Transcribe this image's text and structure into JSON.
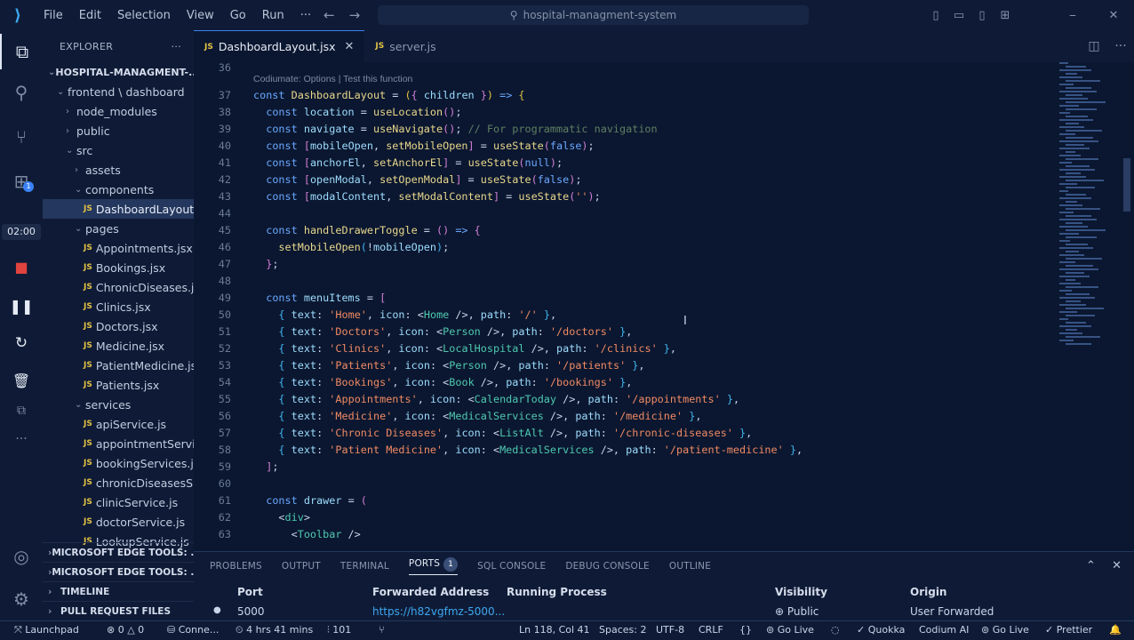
{
  "titlebar": {
    "menu": [
      "File",
      "Edit",
      "Selection",
      "View",
      "Go",
      "Run",
      "···"
    ],
    "search": "hospital-managment-system"
  },
  "activity": {
    "timer": "02:00",
    "badge": "1"
  },
  "explorer": {
    "title": "EXPLORER",
    "root": "HOSPITAL-MANAGMENT-...",
    "items": [
      {
        "label": "frontend \\ dashboard",
        "depth": 1,
        "type": "folder-open"
      },
      {
        "label": "node_modules",
        "depth": 2,
        "type": "folder"
      },
      {
        "label": "public",
        "depth": 2,
        "type": "folder"
      },
      {
        "label": "src",
        "depth": 2,
        "type": "folder-open"
      },
      {
        "label": "assets",
        "depth": 3,
        "type": "folder"
      },
      {
        "label": "components",
        "depth": 3,
        "type": "folder-open"
      },
      {
        "label": "DashboardLayout....",
        "depth": 4,
        "type": "file",
        "selected": true
      },
      {
        "label": "pages",
        "depth": 3,
        "type": "folder-open"
      },
      {
        "label": "Appointments.jsx",
        "depth": 4,
        "type": "file"
      },
      {
        "label": "Bookings.jsx",
        "depth": 4,
        "type": "file"
      },
      {
        "label": "ChronicDiseases.jsx",
        "depth": 4,
        "type": "file"
      },
      {
        "label": "Clinics.jsx",
        "depth": 4,
        "type": "file"
      },
      {
        "label": "Doctors.jsx",
        "depth": 4,
        "type": "file"
      },
      {
        "label": "Medicine.jsx",
        "depth": 4,
        "type": "file"
      },
      {
        "label": "PatientMedicine.jsx",
        "depth": 4,
        "type": "file"
      },
      {
        "label": "Patients.jsx",
        "depth": 4,
        "type": "file"
      },
      {
        "label": "services",
        "depth": 3,
        "type": "folder-open"
      },
      {
        "label": "apiService.js",
        "depth": 4,
        "type": "file"
      },
      {
        "label": "appointmentServi...",
        "depth": 4,
        "type": "file"
      },
      {
        "label": "bookingServices.js",
        "depth": 4,
        "type": "file"
      },
      {
        "label": "chronicDiseasesS...",
        "depth": 4,
        "type": "file"
      },
      {
        "label": "clinicService.js",
        "depth": 4,
        "type": "file"
      },
      {
        "label": "doctorService.js",
        "depth": 4,
        "type": "file"
      },
      {
        "label": "LookupService.js",
        "depth": 4,
        "type": "file"
      }
    ],
    "sections": [
      "MICROSOFT EDGE TOOLS: ...",
      "MICROSOFT EDGE TOOLS: ...",
      "TIMELINE",
      "PULL REQUEST FILES"
    ]
  },
  "tabs": [
    {
      "label": "DashboardLayout.jsx",
      "active": true
    },
    {
      "label": "server.js",
      "active": false
    }
  ],
  "codelens": "Codiumate: Options | Test this function",
  "code": [
    {
      "n": "36",
      "html": ""
    },
    {
      "n": "37",
      "html": "<span class='kw'>const</span> <span class='fn'>DashboardLayout</span> <span class='pun'>=</span> <span class='br1'>(</span><span class='br2'>{</span> <span class='var'>children</span> <span class='br2'>}</span><span class='br1'>)</span> <span class='kw'>=&gt;</span> <span class='br1'>{</span>"
    },
    {
      "n": "38",
      "html": "  <span class='kw'>const</span> <span class='var'>location</span> = <span class='fn'>useLocation</span><span class='br2'>()</span>;"
    },
    {
      "n": "39",
      "html": "  <span class='kw'>const</span> <span class='var'>navigate</span> = <span class='fn'>useNavigate</span><span class='br2'>()</span>; <span class='cm'>// For programmatic navigation</span>"
    },
    {
      "n": "40",
      "html": "  <span class='kw'>const</span> <span class='br2'>[</span><span class='var'>mobileOpen</span>, <span class='fn'>setMobileOpen</span><span class='br2'>]</span> = <span class='fn'>useState</span><span class='br2'>(</span><span class='kw'>false</span><span class='br2'>)</span>;"
    },
    {
      "n": "41",
      "html": "  <span class='kw'>const</span> <span class='br2'>[</span><span class='var'>anchorEl</span>, <span class='fn'>setAnchorEl</span><span class='br2'>]</span> = <span class='fn'>useState</span><span class='br2'>(</span><span class='kw'>null</span><span class='br2'>)</span>;"
    },
    {
      "n": "42",
      "html": "  <span class='kw'>const</span> <span class='br2'>[</span><span class='var'>openModal</span>, <span class='fn'>setOpenModal</span><span class='br2'>]</span> = <span class='fn'>useState</span><span class='br2'>(</span><span class='kw'>false</span><span class='br2'>)</span>;"
    },
    {
      "n": "43",
      "html": "  <span class='kw'>const</span> <span class='br2'>[</span><span class='var'>modalContent</span>, <span class='fn'>setModalContent</span><span class='br2'>]</span> = <span class='fn'>useState</span><span class='br2'>(</span><span class='str'>''</span><span class='br2'>)</span>;"
    },
    {
      "n": "44",
      "html": ""
    },
    {
      "n": "45",
      "html": "  <span class='kw'>const</span> <span class='fn'>handleDrawerToggle</span> = <span class='br2'>()</span> <span class='kw'>=&gt;</span> <span class='br2'>{</span>"
    },
    {
      "n": "46",
      "html": "    <span class='fn'>setMobileOpen</span><span class='br3'>(</span>!<span class='var'>mobileOpen</span><span class='br3'>)</span>;"
    },
    {
      "n": "47",
      "html": "  <span class='br2'>}</span>;"
    },
    {
      "n": "48",
      "html": ""
    },
    {
      "n": "49",
      "html": "  <span class='kw'>const</span> <span class='var'>menuItems</span> = <span class='br2'>[</span>"
    },
    {
      "n": "50",
      "html": "    <span class='br3'>{</span> <span class='var'>text</span>: <span class='str'>'Home'</span>, <span class='var'>icon</span>: &lt;<span class='tag'>Home</span> /&gt;, <span class='var'>path</span>: <span class='str'>'/'</span> <span class='br3'>}</span>,"
    },
    {
      "n": "51",
      "html": "    <span class='br3'>{</span> <span class='var'>text</span>: <span class='str'>'Doctors'</span>, <span class='var'>icon</span>: &lt;<span class='tag'>Person</span> /&gt;, <span class='var'>path</span>: <span class='str'>'/doctors'</span> <span class='br3'>}</span>,"
    },
    {
      "n": "52",
      "html": "    <span class='br3'>{</span> <span class='var'>text</span>: <span class='str'>'Clinics'</span>, <span class='var'>icon</span>: &lt;<span class='tag'>LocalHospital</span> /&gt;, <span class='var'>path</span>: <span class='str'>'/clinics'</span> <span class='br3'>}</span>,"
    },
    {
      "n": "53",
      "html": "    <span class='br3'>{</span> <span class='var'>text</span>: <span class='str'>'Patients'</span>, <span class='var'>icon</span>: &lt;<span class='tag'>Person</span> /&gt;, <span class='var'>path</span>: <span class='str'>'/patients'</span> <span class='br3'>}</span>,"
    },
    {
      "n": "54",
      "html": "    <span class='br3'>{</span> <span class='var'>text</span>: <span class='str'>'Bookings'</span>, <span class='var'>icon</span>: &lt;<span class='tag'>Book</span> /&gt;, <span class='var'>path</span>: <span class='str'>'/bookings'</span> <span class='br3'>}</span>,"
    },
    {
      "n": "55",
      "html": "    <span class='br3'>{</span> <span class='var'>text</span>: <span class='str'>'Appointments'</span>, <span class='var'>icon</span>: &lt;<span class='tag'>CalendarToday</span> /&gt;, <span class='var'>path</span>: <span class='str'>'/appointments'</span> <span class='br3'>}</span>,"
    },
    {
      "n": "56",
      "html": "    <span class='br3'>{</span> <span class='var'>text</span>: <span class='str'>'Medicine'</span>, <span class='var'>icon</span>: &lt;<span class='tag'>MedicalServices</span> /&gt;, <span class='var'>path</span>: <span class='str'>'/medicine'</span> <span class='br3'>}</span>,"
    },
    {
      "n": "57",
      "html": "    <span class='br3'>{</span> <span class='var'>text</span>: <span class='str'>'Chronic Diseases'</span>, <span class='var'>icon</span>: &lt;<span class='tag'>ListAlt</span> /&gt;, <span class='var'>path</span>: <span class='str'>'/chronic-diseases'</span> <span class='br3'>}</span>,"
    },
    {
      "n": "58",
      "html": "    <span class='br3'>{</span> <span class='var'>text</span>: <span class='str'>'Patient Medicine'</span>, <span class='var'>icon</span>: &lt;<span class='tag'>MedicalServices</span> /&gt;, <span class='var'>path</span>: <span class='str'>'/patient-medicine'</span> <span class='br3'>}</span>,"
    },
    {
      "n": "59",
      "html": "  <span class='br2'>]</span>;"
    },
    {
      "n": "60",
      "html": ""
    },
    {
      "n": "61",
      "html": "  <span class='kw'>const</span> <span class='var'>drawer</span> = <span class='br2'>(</span>"
    },
    {
      "n": "62",
      "html": "    &lt;<span class='tag'>div</span>&gt;"
    },
    {
      "n": "63",
      "html": "      &lt;<span class='tag'>Toolbar</span> /&gt;"
    }
  ],
  "panel": {
    "tabs": [
      "PROBLEMS",
      "OUTPUT",
      "TERMINAL",
      "PORTS",
      "SQL CONSOLE",
      "DEBUG CONSOLE",
      "OUTLINE"
    ],
    "ports_count": "1",
    "columns": [
      "Port",
      "Forwarded Address",
      "Running Process",
      "Visibility",
      "Origin"
    ],
    "row": {
      "port": "5000",
      "address": "https://h82vgfmz-5000...",
      "process": "",
      "visibility": "Public",
      "origin": "User Forwarded"
    }
  },
  "status": {
    "remote": "Launchpad",
    "problems": "0 △ 0",
    "connect": "Conne...",
    "time": "4 hrs 41 mins",
    "ports": "101",
    "position": "Ln 118, Col 41",
    "spaces": "Spaces: 2",
    "encoding": "UTF-8",
    "eol": "CRLF",
    "braces": "{}",
    "golive1": "Go Live",
    "quokka": "Quokka",
    "codium": "Codium AI",
    "golive2": "Go Live",
    "prettier": "Prettier"
  }
}
